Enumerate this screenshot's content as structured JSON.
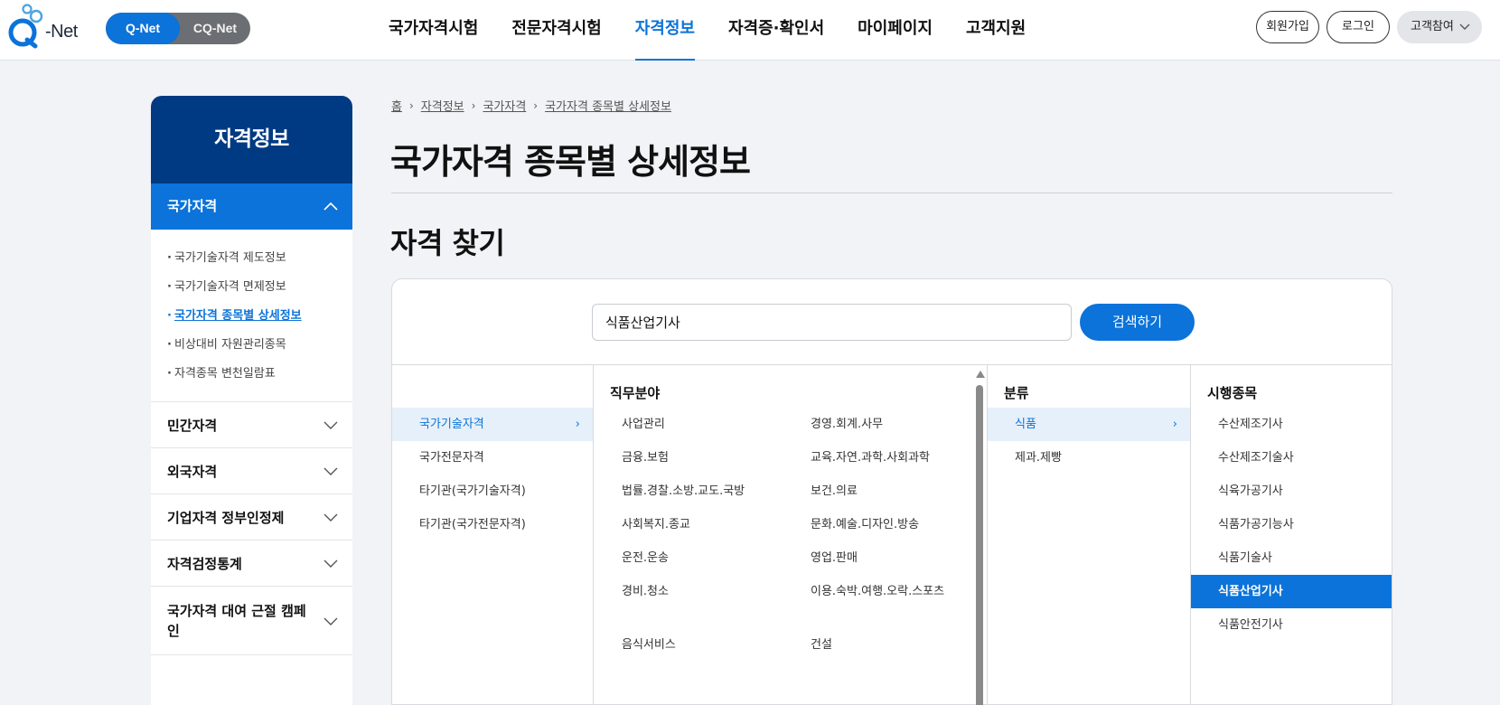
{
  "brand": {
    "logo_text": "-Net"
  },
  "site_toggle": {
    "active": "Q-Net",
    "inactive": "CQ-Net"
  },
  "gnb": [
    {
      "label": "국가자격시험"
    },
    {
      "label": "전문자격시험"
    },
    {
      "label": "자격정보",
      "active": true
    },
    {
      "label": "자격증·확인서"
    },
    {
      "label": "마이페이지"
    },
    {
      "label": "고객지원"
    }
  ],
  "util": {
    "join": "회원가입",
    "login": "로그인",
    "feedback": "고객참여"
  },
  "sidebar": {
    "title": "자격정보",
    "open_section": "국가자격",
    "sub_items": [
      "국가기술자격 제도정보",
      "국가기술자격 면제정보",
      "국가자격 종목별 상세정보",
      "비상대비 자원관리종목",
      "자격종목 변천일람표"
    ],
    "current_sub": "국가자격 종목별 상세정보",
    "sections": [
      "민간자격",
      "외국자격",
      "기업자격 정부인정제",
      "자격검정통계",
      "국가자격 대여 근절 캠페인"
    ]
  },
  "breadcrumb": [
    "홈",
    "자격정보",
    "국가자격",
    "국가자격 종목별 상세정보"
  ],
  "page_title": "국가자격 종목별 상세정보",
  "section_title": "자격 찾기",
  "search": {
    "value": "식품산업기사",
    "button": "검색하기"
  },
  "columns": {
    "type": {
      "items": [
        "국가기술자격",
        "국가전문자격",
        "타기관(국가기술자격)",
        "타기관(국가전문자격)"
      ],
      "selected": "국가기술자격"
    },
    "field": {
      "header": "직무분야",
      "items_left": [
        "사업관리",
        "금융.보험",
        "법률.경찰.소방.교도.국방",
        "사회복지.종교",
        "운전.운송",
        "경비.청소",
        "음식서비스"
      ],
      "items_right": [
        "경영.회계.사무",
        "교육.자연.과학.사회과학",
        "보건.의료",
        "문화.예술.디자인.방송",
        "영업.판매",
        "이용.숙박.여행.오락.스포츠",
        "건설"
      ]
    },
    "category": {
      "header": "분류",
      "items": [
        "식품",
        "제과.제빵"
      ],
      "selected": "식품"
    },
    "exam": {
      "header": "시행종목",
      "items": [
        "수산제조기사",
        "수산제조기술사",
        "식육가공기사",
        "식품가공기능사",
        "식품기술사",
        "식품산업기사",
        "식품안전기사"
      ],
      "selected": "식품산업기사"
    }
  },
  "colors": {
    "primary": "#0b73d9",
    "navy": "#003a82",
    "selected_bg": "#e6f0fa"
  }
}
